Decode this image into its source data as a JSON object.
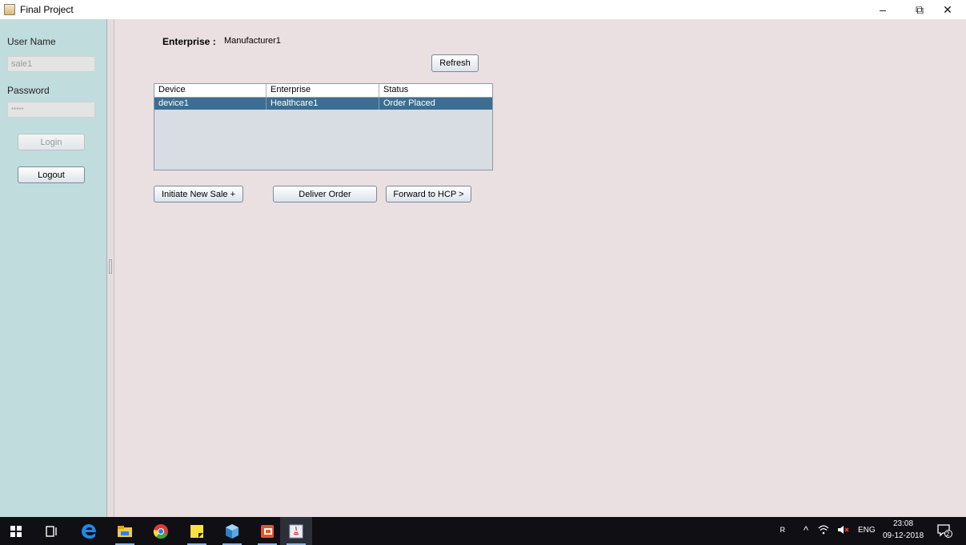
{
  "window": {
    "title": "Final Project",
    "controls": {
      "minimize": "–",
      "maximize": "⧉",
      "close": "✕"
    }
  },
  "login_panel": {
    "username_label": "User Name",
    "username_value": "sale1",
    "password_label": "Password",
    "password_value": "*****",
    "login_button": "Login",
    "logout_button": "Logout"
  },
  "main": {
    "enterprise_label": "Enterprise :",
    "enterprise_value": "Manufacturer1",
    "refresh_button": "Refresh",
    "table": {
      "columns": [
        "Device",
        "Enterprise",
        "Status"
      ],
      "rows": [
        {
          "device": "device1",
          "enterprise": "Healthcare1",
          "status": "Order Placed",
          "selected": true
        }
      ]
    },
    "buttons": {
      "initiate_sale": "Initiate New Sale +",
      "deliver_order": "Deliver Order",
      "forward_hcp": "Forward to HCP >"
    }
  },
  "taskbar": {
    "apps": [
      "windows-start-icon",
      "task-view-icon",
      "edge-icon",
      "file-explorer-icon",
      "chrome-icon",
      "sticky-notes-icon",
      "app-cube-icon",
      "office-icon",
      "java-icon"
    ],
    "tray": {
      "language": "ENG",
      "time": "23:08",
      "date": "09-12-2018",
      "notifications": "2"
    }
  },
  "colors": {
    "left_panel": "#c1dcdc",
    "main_panel": "#eadfe1",
    "selection": "#3b6e91",
    "taskbar": "#0f0f14"
  }
}
